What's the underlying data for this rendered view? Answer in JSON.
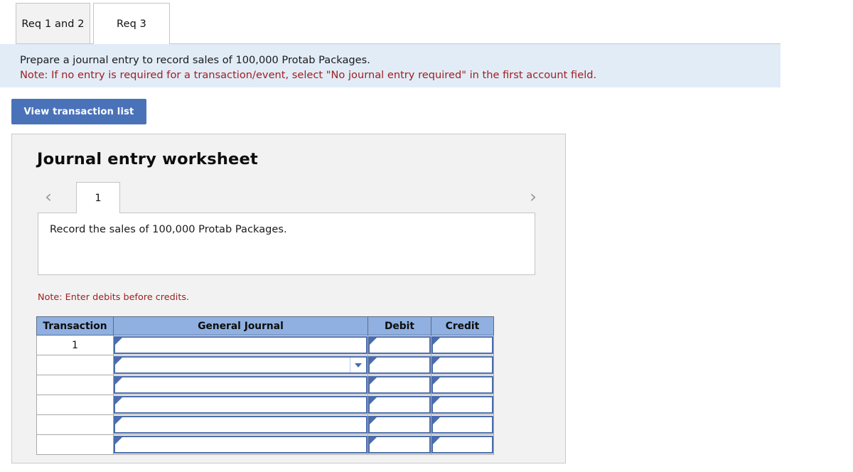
{
  "tabs": [
    {
      "label": "Req 1 and 2",
      "active": false
    },
    {
      "label": "Req 3",
      "active": true
    }
  ],
  "banner": {
    "instruction": "Prepare a journal entry to record sales of 100,000 Protab Packages.",
    "note": "Note: If no entry is required for a transaction/event, select \"No journal entry required\" in the first account field."
  },
  "toolbar": {
    "view_transaction_list_label": "View transaction list"
  },
  "worksheet": {
    "title": "Journal entry worksheet",
    "prev_icon": "chevron-left-icon",
    "next_icon": "chevron-right-icon",
    "pages": [
      {
        "label": "1",
        "active": true
      }
    ],
    "description": "Record the sales of 100,000 Protab Packages.",
    "note_debits_credits": "Note: Enter debits before credits.",
    "table": {
      "columns": [
        "Transaction",
        "General Journal",
        "Debit",
        "Credit"
      ],
      "rows": [
        {
          "transaction": "1",
          "general_journal": "",
          "debit": "",
          "credit": "",
          "has_dropdown": false
        },
        {
          "transaction": "",
          "general_journal": "",
          "debit": "",
          "credit": "",
          "has_dropdown": true
        },
        {
          "transaction": "",
          "general_journal": "",
          "debit": "",
          "credit": "",
          "has_dropdown": false
        },
        {
          "transaction": "",
          "general_journal": "",
          "debit": "",
          "credit": "",
          "has_dropdown": false
        },
        {
          "transaction": "",
          "general_journal": "",
          "debit": "",
          "credit": "",
          "has_dropdown": false
        },
        {
          "transaction": "",
          "general_journal": "",
          "debit": "",
          "credit": "",
          "has_dropdown": false
        }
      ]
    }
  },
  "colors": {
    "accent_button": "#4a72b8",
    "banner_bg": "#e1ecf7",
    "table_header_bg": "#8fb0e0",
    "input_border": "#4a6cae",
    "note_text": "#a02020"
  }
}
